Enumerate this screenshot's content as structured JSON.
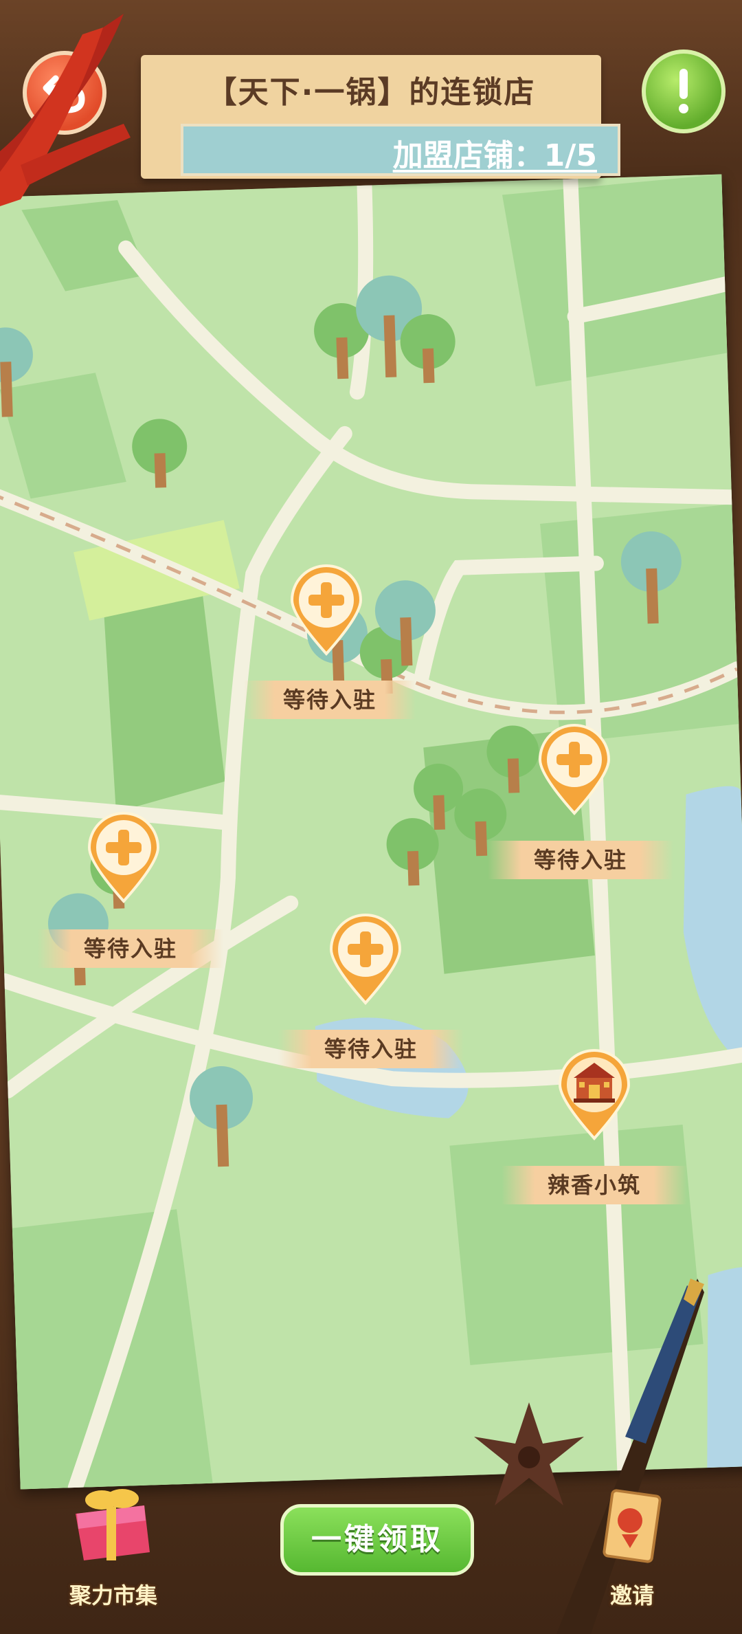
{
  "header": {
    "title": "【天下·一锅】的连锁店",
    "franchise_label": "加盟店铺：1/5"
  },
  "buttons": {
    "back_icon": "undo-arrow-icon",
    "info_icon": "exclamation-icon",
    "collect_all": "一键领取",
    "market": "聚力市集",
    "invite": "邀请"
  },
  "slots": [
    {
      "label": "等待入驻",
      "state": "empty"
    },
    {
      "label": "等待入驻",
      "state": "empty"
    },
    {
      "label": "等待入驻",
      "state": "empty"
    },
    {
      "label": "等待入驻",
      "state": "empty"
    },
    {
      "label": "辣香小筑",
      "state": "occupied"
    }
  ],
  "colors": {
    "map_green": "#bfe3a9",
    "road": "#f3f1df",
    "pin_orange": "#f5a53a",
    "accent_green": "#62ad2c",
    "back_red": "#e24c2a"
  }
}
